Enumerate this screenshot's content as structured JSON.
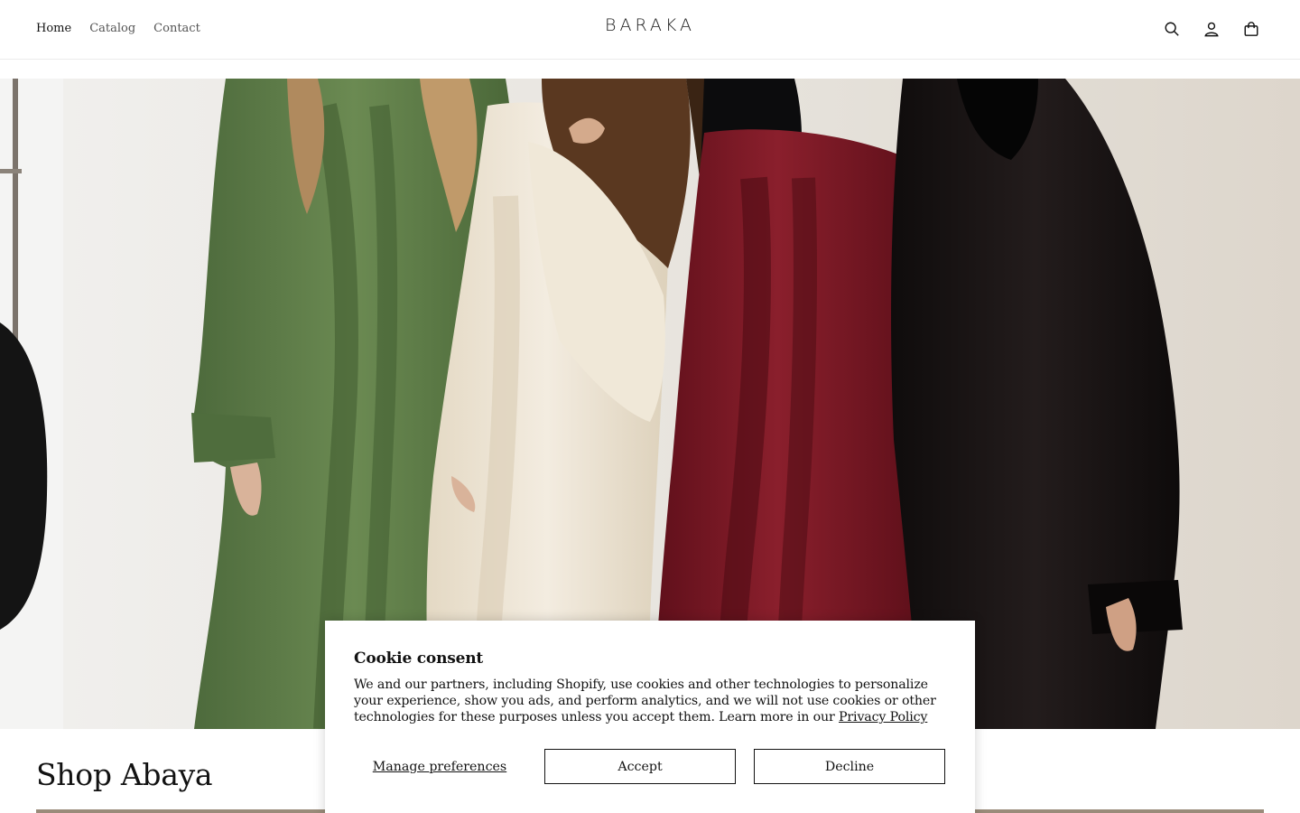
{
  "header": {
    "nav": [
      {
        "label": "Home",
        "active": true
      },
      {
        "label": "Catalog",
        "active": false
      },
      {
        "label": "Contact",
        "active": false
      }
    ],
    "logo": "BARAKA",
    "icons": [
      "search-icon",
      "account-icon",
      "cart-icon"
    ]
  },
  "section": {
    "title": "Shop Abaya"
  },
  "cookie": {
    "title": "Cookie consent",
    "body": "We and our partners, including Shopify, use cookies and other technologies to personalize your experience, show you ads, and perform analytics, and we will not use cookies or other technologies for these purposes unless you accept them. Learn more in our ",
    "policy_link": "Privacy Policy",
    "manage_label": "Manage preferences",
    "accept_label": "Accept",
    "decline_label": "Decline"
  },
  "colors": {
    "text": "#121212",
    "border": "#ececec",
    "green_abaya": "#5e7a48",
    "cream_abaya": "#ece3d2",
    "red_abaya": "#7a1a25",
    "black_abaya": "#151212"
  }
}
